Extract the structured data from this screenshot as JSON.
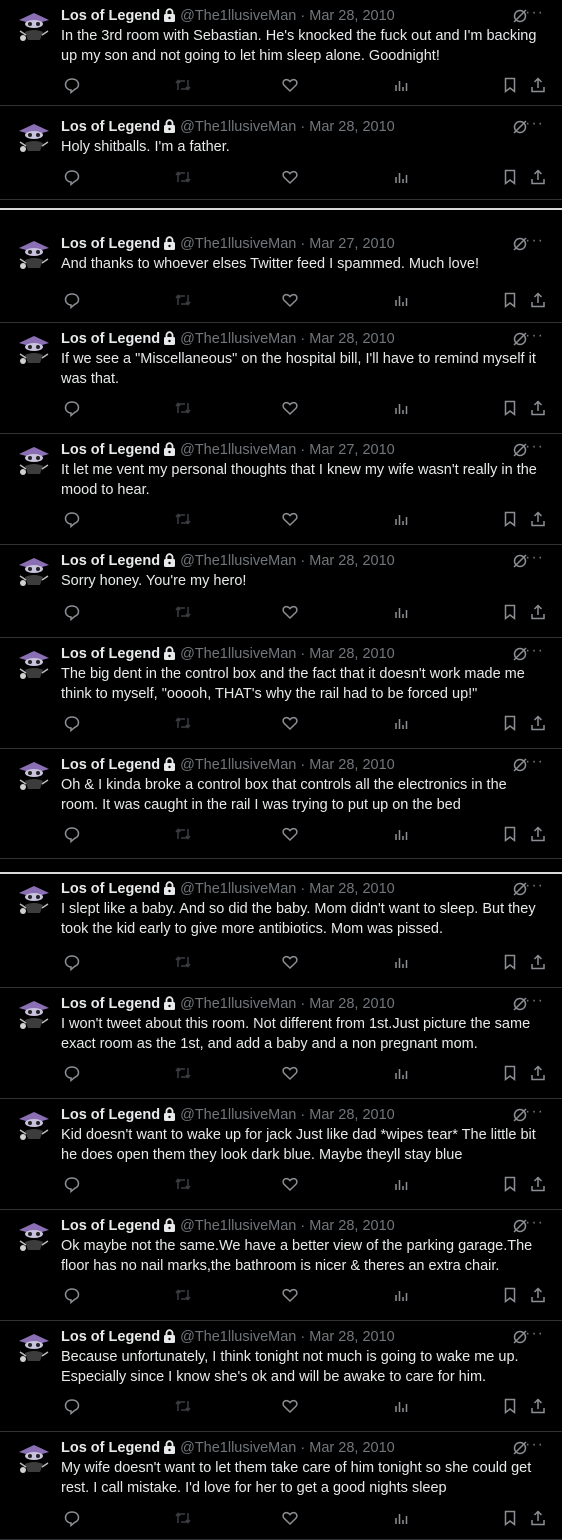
{
  "author": {
    "display_name": "Los of Legend",
    "handle": "@The1llusiveMan"
  },
  "icons": {
    "avatar": "purple-cartoon-character-avatar",
    "protected": "lock-icon",
    "grok": "grok-icon",
    "more": "more-icon",
    "reply": "reply-icon",
    "retweet": "retweet-icon",
    "like": "like-icon",
    "views": "views-icon",
    "bookmark": "bookmark-icon",
    "share": "share-icon"
  },
  "colors": {
    "background": "#000000",
    "text": "#e7e9ea",
    "muted": "#71767b",
    "divider": "#2f3336"
  },
  "tweets": [
    {
      "date": "Mar 28, 2010",
      "text": "In the 3rd room with Sebastian. He's knocked the fuck out and I'm backing up my son and not going to let him sleep alone. Goodnight!"
    },
    {
      "date": "Mar 28, 2010",
      "text": "Holy shitballs. I'm a father."
    },
    {
      "date": "Mar 27, 2010",
      "text": "And thanks to whoever elses Twitter feed I spammed. Much love!"
    },
    {
      "date": "Mar 28, 2010",
      "text": "If we see a \"Miscellaneous\" on the hospital bill, I'll have to remind myself it was that."
    },
    {
      "date": "Mar 27, 2010",
      "text": "It let me vent my personal thoughts that I knew my wife wasn't really in the mood to hear."
    },
    {
      "date": "Mar 28, 2010",
      "text": "Sorry honey. You're my hero!"
    },
    {
      "date": "Mar 28, 2010",
      "text": "The big dent in the control box and the fact that it doesn't work made me think to myself, \"ooooh, THAT's why the rail had to be forced up!\""
    },
    {
      "date": "Mar 28, 2010",
      "text": "Oh & I kinda broke a control box that controls all the electronics in the room. It was caught in the rail I was trying to put up on the bed"
    },
    {
      "date": "Mar 28, 2010",
      "text": "I slept like a baby. And so did the baby. Mom didn't want to sleep. But they took the kid early to give more antibiotics. Mom was pissed."
    },
    {
      "date": "Mar 28, 2010",
      "text": "I won't tweet about this room. Not different from 1st.Just picture the same exact room as the 1st, and add a baby and a non pregnant mom."
    },
    {
      "date": "Mar 28, 2010",
      "text": "Kid doesn't want to wake up for jack Just like dad *wipes tear* The little bit he does open them they look dark blue. Maybe theyll stay blue"
    },
    {
      "date": "Mar 28, 2010",
      "text": "Ok maybe not the same.We have a better view of the parking garage.The floor has no nail marks,the bathroom is nicer & theres an extra chair."
    },
    {
      "date": "Mar 28, 2010",
      "text": "Because unfortunately, I think tonight not much is going to wake me up. Especially since I know she's ok and will be awake to care for him."
    },
    {
      "date": "Mar 28, 2010",
      "text": "My wife doesn't want to let them take care of him tonight so she could get rest. I call mistake. I'd love for her to get a good nights sleep"
    }
  ]
}
